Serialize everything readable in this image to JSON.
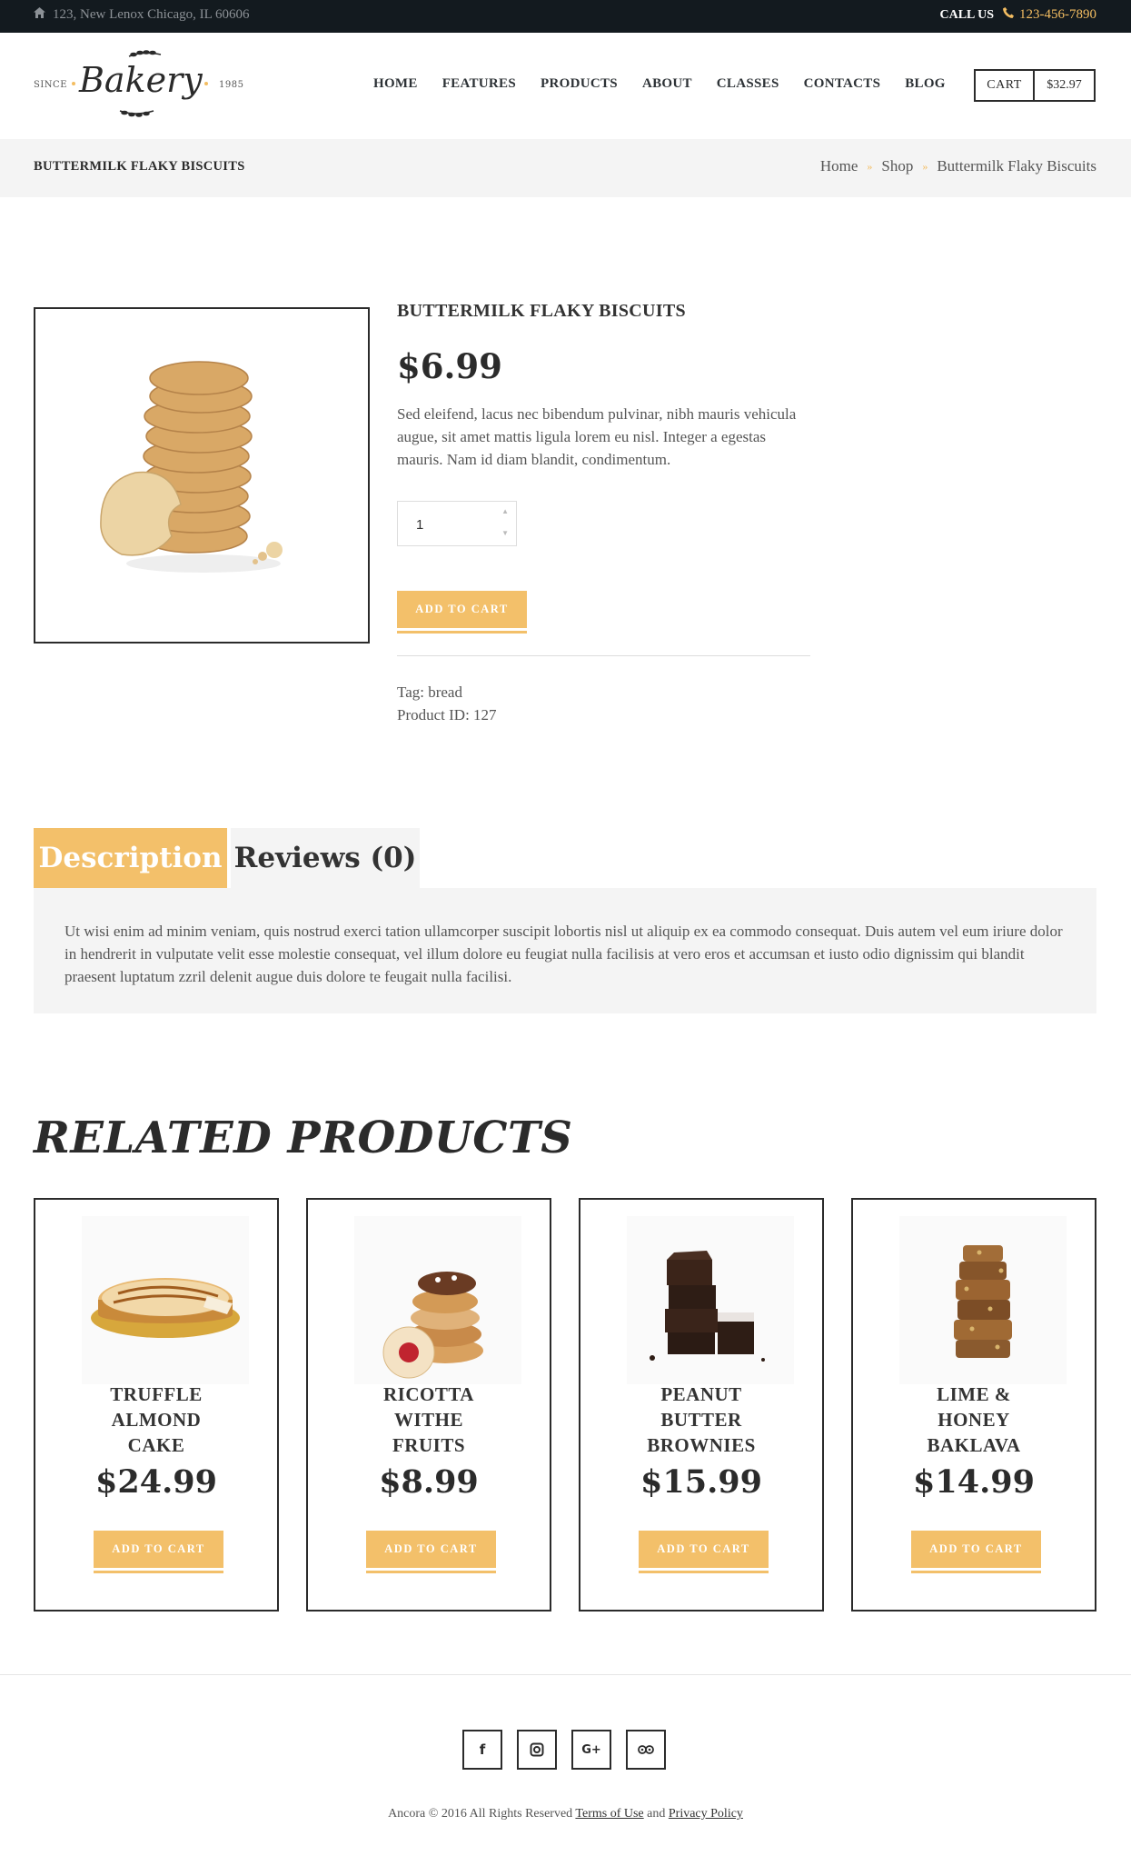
{
  "topbar": {
    "address": "123, New Lenox Chicago, IL 60606",
    "call_label": "CALL US",
    "phone": "123-456-7890"
  },
  "logo": {
    "since": "SINCE",
    "name": "Bakery",
    "year": "1985"
  },
  "nav": [
    "HOME",
    "FEATURES",
    "PRODUCTS",
    "ABOUT",
    "CLASSES",
    "CONTACTS",
    "BLOG"
  ],
  "cart": {
    "label": "CART",
    "total": "$32.97"
  },
  "page_title": "BUTTERMILK FLAKY BISCUITS",
  "breadcrumb": [
    "Home",
    "Shop",
    "Buttermilk Flaky Biscuits"
  ],
  "product": {
    "name": "BUTTERMILK FLAKY BISCUITS",
    "price": "$6.99",
    "description": "Sed eleifend, lacus nec bibendum pulvinar, nibh mauris vehicula augue, sit amet mattis ligula lorem eu nisl. Integer a egestas mauris. Nam id diam blandit, condimentum.",
    "quantity": "1",
    "add_to_cart": "ADD TO CART",
    "tag": "Tag: bread",
    "product_id": "Product ID: 127"
  },
  "tabs": {
    "description_label": "Description",
    "reviews_label": "Reviews (0)",
    "description_text": "Ut wisi enim ad minim veniam, quis nostrud exerci tation ullamcorper suscipit lobortis nisl ut aliquip ex ea commodo consequat. Duis autem vel eum iriure dolor in hendrerit in vulputate velit esse molestie consequat, vel illum dolore eu feugiat nulla facilisis at vero eros et accumsan et iusto odio dignissim qui blandit praesent luptatum zzril delenit augue duis dolore te feugait nulla facilisi."
  },
  "related": {
    "title": "RELATED PRODUCTS",
    "items": [
      {
        "name": "TRUFFLE ALMOND CAKE",
        "price": "$24.99",
        "button": "ADD TO CART"
      },
      {
        "name": "RICOTTA WITHE FRUITS",
        "price": "$8.99",
        "button": "ADD TO CART"
      },
      {
        "name": "PEANUT BUTTER BROWNIES",
        "price": "$15.99",
        "button": "ADD TO CART"
      },
      {
        "name": "LIME & HONEY BAKLAVA",
        "price": "$14.99",
        "button": "ADD TO CART"
      }
    ]
  },
  "footer": {
    "social": [
      "facebook-icon",
      "instagram-icon",
      "google-plus-icon",
      "tripadvisor-icon"
    ],
    "copyright": "Ancora © 2016 All Rights Reserved",
    "terms": "Terms of Use",
    "and": "and",
    "privacy": "Privacy Policy"
  },
  "colors": {
    "accent": "#f3c06a",
    "dark": "#131a1f",
    "panel": "#f4f4f4"
  }
}
